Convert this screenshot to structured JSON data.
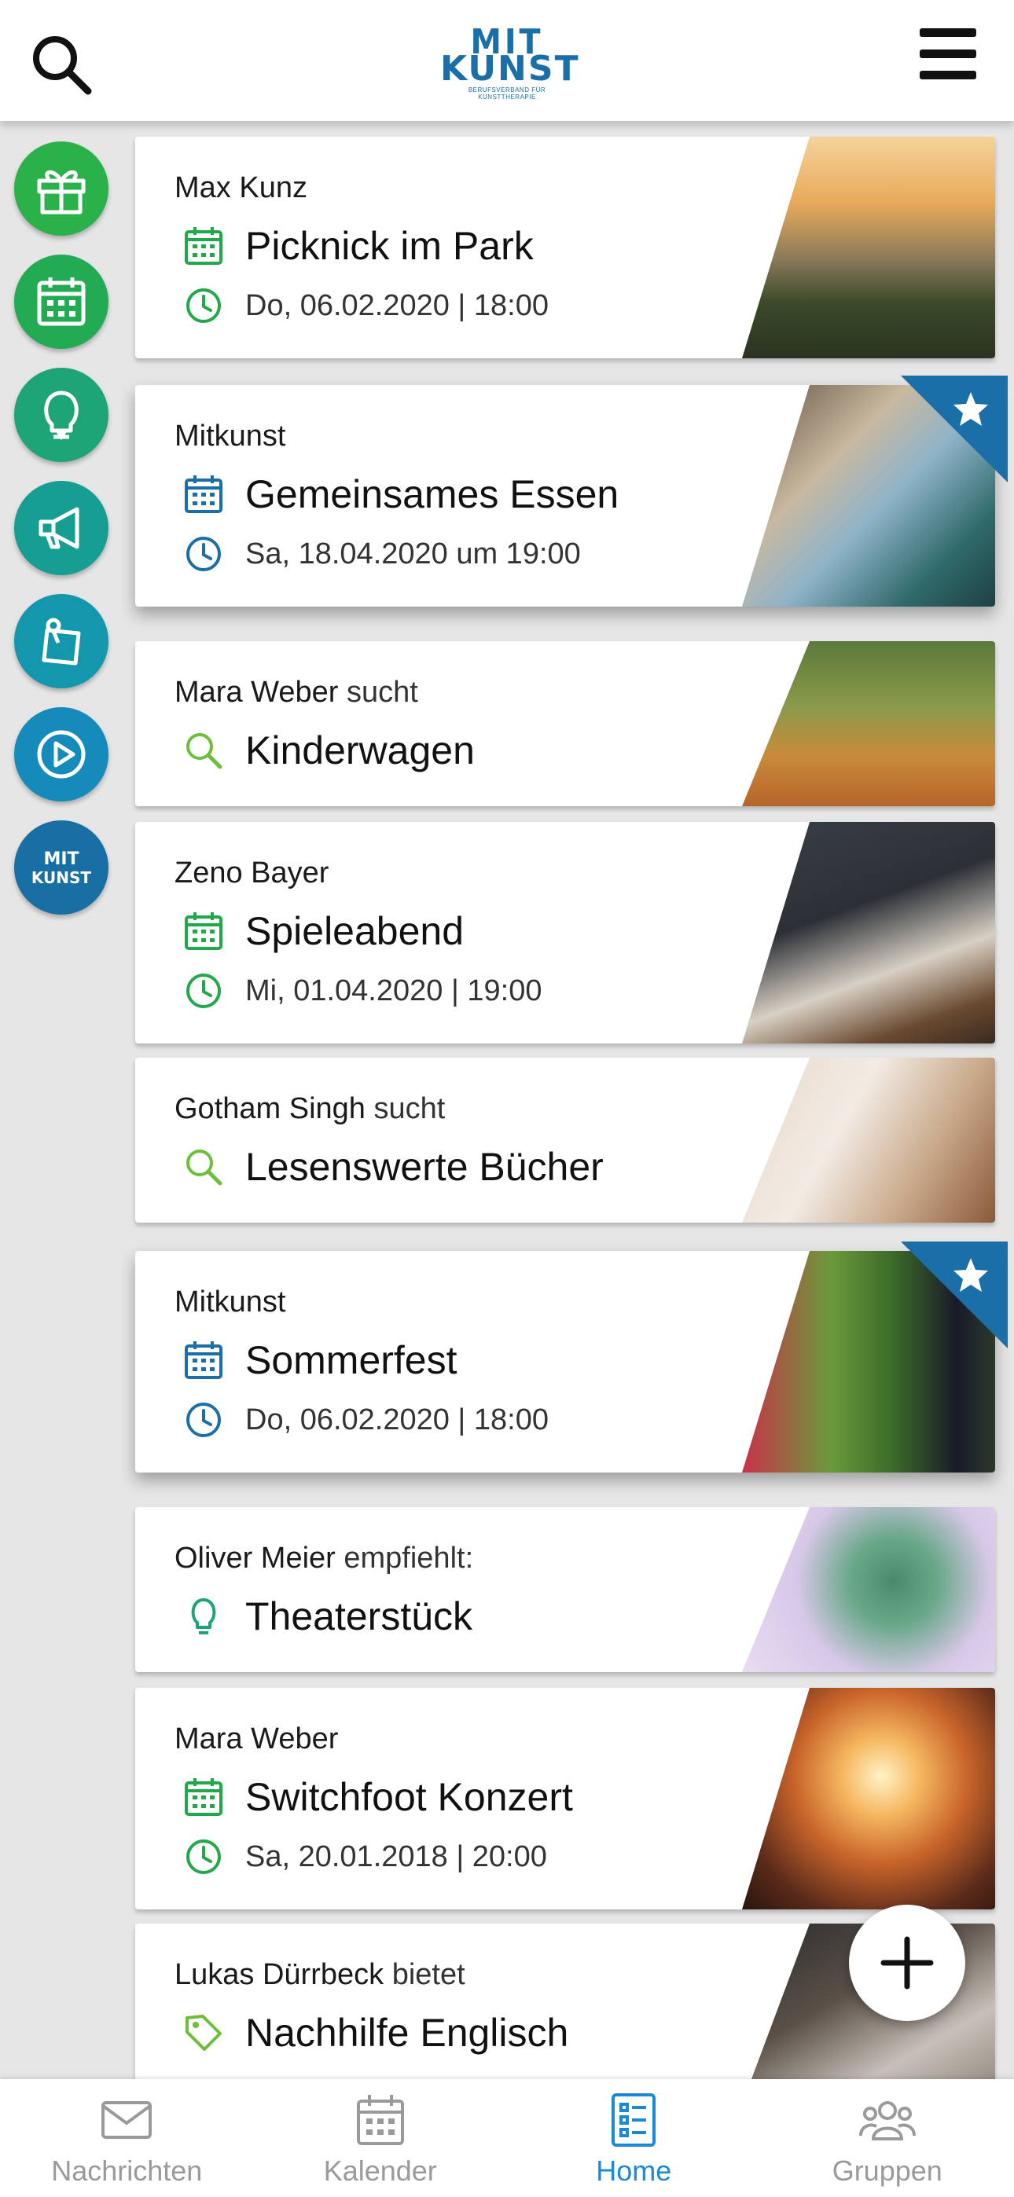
{
  "header": {
    "logo_line1": "MIT",
    "logo_line2": "KUNST",
    "logo_tagline": "BERUFSVERBAND FÜR KUNSTTHERAPIE"
  },
  "side_nav": [
    {
      "icon": "gift-icon",
      "color": "#2bb14a"
    },
    {
      "icon": "calendar-icon",
      "color": "#22ab52"
    },
    {
      "icon": "lightbulb-icon",
      "color": "#1ea577"
    },
    {
      "icon": "megaphone-icon",
      "color": "#169e92"
    },
    {
      "icon": "pin-note-icon",
      "color": "#1297ad"
    },
    {
      "icon": "play-icon",
      "color": "#148bbb"
    },
    {
      "icon": "mitkunst-logo-icon",
      "color": "#176fa3"
    }
  ],
  "cards": [
    {
      "author": "Max Kunz",
      "verb": "",
      "title": "Picknick im Park",
      "date": "Do, 06.02.2020 | 18:00",
      "type": "event",
      "accent": "#22a84a",
      "featured": false
    },
    {
      "author": "Mitkunst",
      "verb": "",
      "title": "Gemeinsames Essen",
      "date": "Sa, 18.04.2020 um 19:00",
      "type": "event",
      "accent": "#1b6fa8",
      "featured": true
    },
    {
      "author": "Mara Weber",
      "verb": "sucht",
      "title": "Kinderwagen",
      "date": "",
      "type": "search",
      "accent": "#6cbf3a",
      "featured": false
    },
    {
      "author": "Zeno Bayer",
      "verb": "",
      "title": "Spieleabend",
      "date": "Mi, 01.04.2020 | 19:00",
      "type": "event",
      "accent": "#22a84a",
      "featured": false
    },
    {
      "author": "Gotham Singh",
      "verb": "sucht",
      "title": "Lesenswerte Bücher",
      "date": "",
      "type": "search",
      "accent": "#6cbf3a",
      "featured": false
    },
    {
      "author": "Mitkunst",
      "verb": "",
      "title": "Sommerfest",
      "date": "Do, 06.02.2020 | 18:00",
      "type": "event",
      "accent": "#1b6fa8",
      "featured": true
    },
    {
      "author": "Oliver Meier",
      "verb": "empfiehlt:",
      "title": "Theaterstück",
      "date": "",
      "type": "tip",
      "accent": "#1ea577",
      "featured": false
    },
    {
      "author": "Mara Weber",
      "verb": "",
      "title": "Switchfoot Konzert",
      "date": "Sa, 20.01.2018 | 20:00",
      "type": "event",
      "accent": "#22a84a",
      "featured": false
    },
    {
      "author": "Lukas Dürrbeck",
      "verb": "bietet",
      "title": "Nachhilfe Englisch",
      "date": "",
      "type": "offer",
      "accent": "#6cbf3a",
      "featured": false
    }
  ],
  "bottom_nav": [
    {
      "label": "Nachrichten",
      "icon": "mail-icon",
      "active": false
    },
    {
      "label": "Kalender",
      "icon": "calendar-icon",
      "active": false
    },
    {
      "label": "Home",
      "icon": "list-icon",
      "active": true
    },
    {
      "label": "Gruppen",
      "icon": "group-icon",
      "active": false
    }
  ],
  "colors": {
    "active_tab": "#1b8ad6",
    "inactive_tab": "#9a9a9a",
    "brand_blue": "#1b6fa8"
  }
}
